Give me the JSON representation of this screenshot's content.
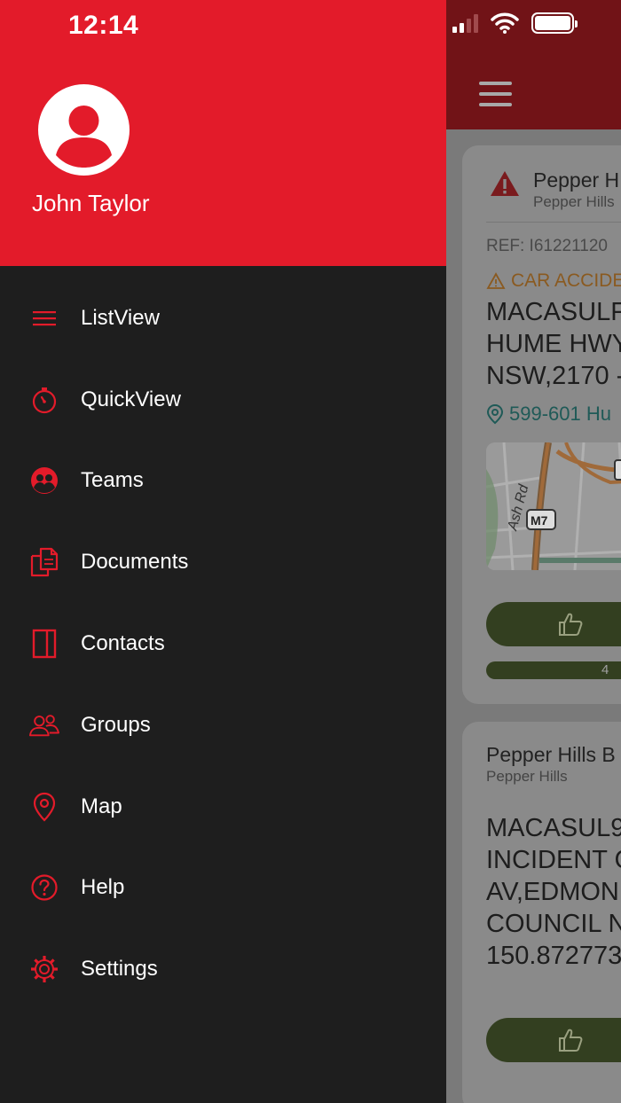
{
  "status_bar": {
    "time": "12:14"
  },
  "drawer": {
    "user_name": "John Taylor",
    "menu": [
      {
        "label": "ListView",
        "icon": "list-icon"
      },
      {
        "label": "QuickView",
        "icon": "stopwatch-icon"
      },
      {
        "label": "Teams",
        "icon": "team-icon"
      },
      {
        "label": "Documents",
        "icon": "documents-icon"
      },
      {
        "label": "Contacts",
        "icon": "contacts-book-icon"
      },
      {
        "label": "Groups",
        "icon": "groups-icon"
      },
      {
        "label": "Map",
        "icon": "map-pin-icon"
      },
      {
        "label": "Help",
        "icon": "help-icon"
      },
      {
        "label": "Settings",
        "icon": "settings-gear-icon"
      }
    ]
  },
  "background": {
    "card1": {
      "title": "Pepper H",
      "subtitle": "Pepper Hills",
      "ref": "REF: I61221120",
      "type": "CAR ACCIDE",
      "lines": [
        "MACASULF",
        "HUME HWY",
        "NSW,2170 -"
      ],
      "address": "599-601 Hu",
      "map_labels": {
        "road": "Ash Rd",
        "shield": "M7"
      },
      "progress_value": "4"
    },
    "card2": {
      "title": "Pepper Hills B",
      "subtitle": "Pepper Hills",
      "lines": [
        "MACASUL9",
        "INCIDENT C",
        "AV,EDMON",
        "COUNCIL N",
        "150.872773"
      ]
    }
  },
  "colors": {
    "accent_red": "#e31b2a",
    "drawer_bg": "#1e1e1e",
    "like_green": "#4a5a2e"
  }
}
